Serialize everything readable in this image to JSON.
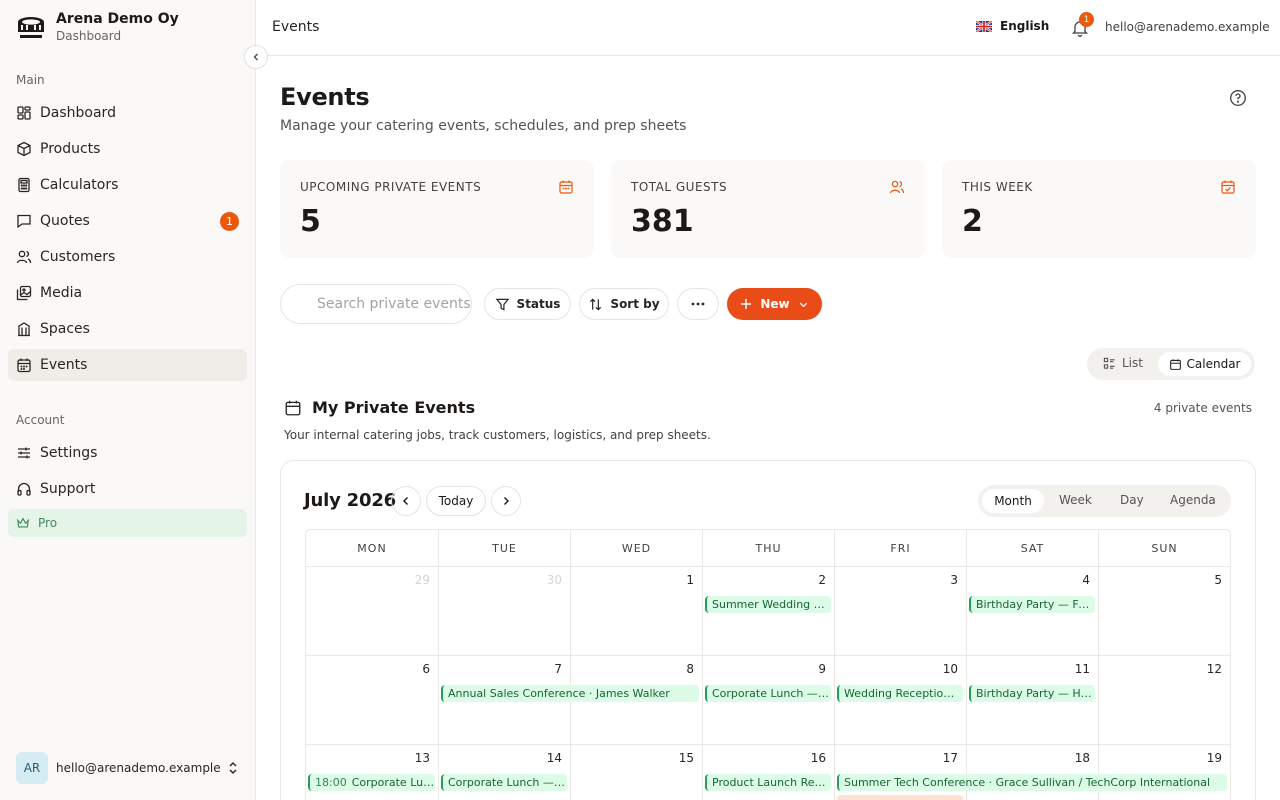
{
  "sidebar": {
    "brand_name": "Arena Demo Oy",
    "brand_sub": "Dashboard",
    "main_label": "Main",
    "account_label": "Account",
    "items": [
      {
        "label": "Dashboard",
        "icon": "dashboard-icon"
      },
      {
        "label": "Products",
        "icon": "package-icon"
      },
      {
        "label": "Calculators",
        "icon": "calculator-icon"
      },
      {
        "label": "Quotes",
        "icon": "message-icon",
        "badge": "1"
      },
      {
        "label": "Customers",
        "icon": "users-icon"
      },
      {
        "label": "Media",
        "icon": "images-icon"
      },
      {
        "label": "Spaces",
        "icon": "building-icon"
      },
      {
        "label": "Events",
        "icon": "calendar-icon",
        "active": true
      }
    ],
    "account_items": [
      {
        "label": "Settings",
        "icon": "sliders-icon"
      },
      {
        "label": "Support",
        "icon": "headphones-icon"
      }
    ],
    "pro_label": "Pro",
    "user_initials": "AR",
    "user_email": "hello@arenademo.example"
  },
  "topbar": {
    "title": "Events",
    "language": "English",
    "notification_count": "1",
    "email": "hello@arenademo.example"
  },
  "page": {
    "title": "Events",
    "subtitle": "Manage your catering events, schedules, and prep sheets"
  },
  "stats": [
    {
      "label": "UPCOMING PRIVATE EVENTS",
      "value": "5",
      "icon": "calendar-icon"
    },
    {
      "label": "TOTAL GUESTS",
      "value": "381",
      "icon": "users-icon"
    },
    {
      "label": "THIS WEEK",
      "value": "2",
      "icon": "calendar-check-icon"
    }
  ],
  "toolbar": {
    "search_placeholder": "Search private events",
    "status_label": "Status",
    "sort_label": "Sort by",
    "new_label": "New"
  },
  "view_toggle": {
    "list": "List",
    "calendar": "Calendar",
    "active": "Calendar"
  },
  "section": {
    "title": "My Private Events",
    "count": "4 private events",
    "description": "Your internal catering jobs, track customers, logistics, and prep sheets."
  },
  "calendar": {
    "month_label": "July 2026",
    "today_label": "Today",
    "views": [
      "Month",
      "Week",
      "Day",
      "Agenda"
    ],
    "active_view": "Month",
    "weekdays": [
      "MON",
      "TUE",
      "WED",
      "THU",
      "FRI",
      "SAT",
      "SUN"
    ],
    "weeks": [
      [
        {
          "d": "29",
          "muted": true
        },
        {
          "d": "30",
          "muted": true
        },
        {
          "d": "1"
        },
        {
          "d": "2"
        },
        {
          "d": "3"
        },
        {
          "d": "4"
        },
        {
          "d": "5"
        }
      ],
      [
        {
          "d": "6"
        },
        {
          "d": "7"
        },
        {
          "d": "8"
        },
        {
          "d": "9"
        },
        {
          "d": "10"
        },
        {
          "d": "11"
        },
        {
          "d": "12"
        }
      ],
      [
        {
          "d": "13"
        },
        {
          "d": "14"
        },
        {
          "d": "15"
        },
        {
          "d": "16"
        },
        {
          "d": "17"
        },
        {
          "d": "18"
        },
        {
          "d": "19"
        }
      ]
    ],
    "events": [
      {
        "week": 0,
        "col": 3,
        "span": 1,
        "title": "Summer Wedding …"
      },
      {
        "week": 0,
        "col": 5,
        "span": 1,
        "title": "Birthday Party — Fo…"
      },
      {
        "week": 1,
        "col": 1,
        "span": 2,
        "title": "Annual Sales Conference · James Walker"
      },
      {
        "week": 1,
        "col": 3,
        "span": 1,
        "title": "Corporate Lunch — …"
      },
      {
        "week": 1,
        "col": 4,
        "span": 1,
        "title": "Wedding Receptio…"
      },
      {
        "week": 1,
        "col": 5,
        "span": 1,
        "title": "Birthday Party — Ha…"
      },
      {
        "week": 2,
        "col": 0,
        "span": 1,
        "time": "18:00",
        "title": "Corporate Lu…"
      },
      {
        "week": 2,
        "col": 1,
        "span": 1,
        "title": "Corporate Lunch — …"
      },
      {
        "week": 2,
        "col": 3,
        "span": 1,
        "title": "Product Launch Re…"
      },
      {
        "week": 2,
        "col": 4,
        "span": 3,
        "title": "Summer Tech Conference · Grace Sullivan / TechCorp International"
      }
    ]
  },
  "colors": {
    "accent": "#ea4c17",
    "event_bg": "#dcfce7",
    "event_border": "#22a05a",
    "pro_bg": "#e4f4e9"
  }
}
